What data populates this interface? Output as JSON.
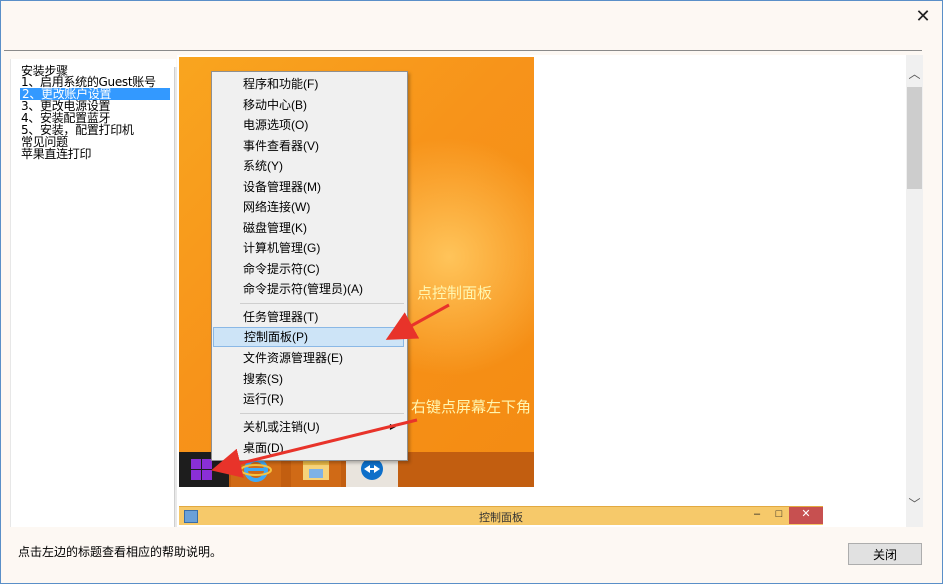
{
  "window": {
    "close_glyph": "✕"
  },
  "toc": {
    "items": [
      {
        "label": "安装步骤",
        "selected": false
      },
      {
        "label": "1、启用系统的Guest账号",
        "selected": false
      },
      {
        "label": "2、更改账户设置",
        "selected": true
      },
      {
        "label": "3、更改电源设置",
        "selected": false
      },
      {
        "label": "4、安装配置蓝牙",
        "selected": false
      },
      {
        "label": "5、安装，配置打印机",
        "selected": false
      },
      {
        "label": "常见问题",
        "selected": false
      },
      {
        "label": "苹果直连打印",
        "selected": false
      }
    ]
  },
  "context_menu": {
    "group1": [
      "程序和功能(F)",
      "移动中心(B)",
      "电源选项(O)",
      "事件查看器(V)",
      "系统(Y)",
      "设备管理器(M)",
      "网络连接(W)",
      "磁盘管理(K)",
      "计算机管理(G)",
      "命令提示符(C)",
      "命令提示符(管理员)(A)"
    ],
    "group2": [
      {
        "label": "任务管理器(T)",
        "highlighted": false
      },
      {
        "label": "控制面板(P)",
        "highlighted": true
      },
      {
        "label": "文件资源管理器(E)",
        "highlighted": false
      },
      {
        "label": "搜索(S)",
        "highlighted": false
      },
      {
        "label": "运行(R)",
        "highlighted": false
      }
    ],
    "group3": [
      {
        "label": "关机或注销(U)",
        "submenu": true
      },
      {
        "label": "桌面(D)",
        "submenu": false
      }
    ]
  },
  "annotations": {
    "click_control_panel": "点控制面板",
    "right_click_corner": "右键点屏幕左下角"
  },
  "control_panel_window": {
    "title": "控制面板",
    "min": "–",
    "max": "□",
    "close": "✕"
  },
  "footer": {
    "hint": "点击左边的标题查看相应的帮助说明。",
    "close_button": "关闭"
  },
  "colors": {
    "accent_selection": "#3399ff",
    "annotation_arrow": "#e8332a",
    "wallpaper": "#f7931a"
  }
}
